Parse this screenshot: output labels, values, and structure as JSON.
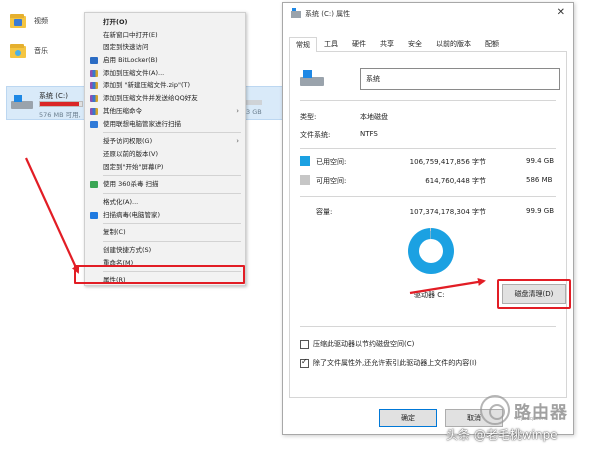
{
  "explorer": {
    "folders": [
      {
        "label": "视频",
        "icon": "video-folder-icon"
      },
      {
        "label": "音乐",
        "icon": "music-folder-icon"
      }
    ],
    "drive": {
      "name": "系统 (C:)",
      "free_text": "576 MB 可用,",
      "usage_fraction": 0.92,
      "bar_color": "#da2626"
    },
    "drive2_free_text": "3 GB"
  },
  "context_menu": {
    "items": [
      {
        "label": "打开(O)",
        "bold": true
      },
      {
        "label": "在新窗口中打开(E)"
      },
      {
        "label": "固定到快速访问"
      },
      {
        "label": "启用 BitLocker(B)",
        "icon": "bitlocker-shield-icon"
      },
      {
        "label": "添加到压缩文件(A)...",
        "icon": "winrar-icon"
      },
      {
        "label": "添加到 \"新建压缩文件.zip\"(T)",
        "icon": "winrar-icon"
      },
      {
        "label": "添加到压缩文件并发送给QQ好友",
        "icon": "winrar-icon"
      },
      {
        "label": "其他压缩命令",
        "icon": "winrar-icon",
        "submenu": true
      },
      {
        "label": "使用联想电脑管家进行扫描",
        "icon": "lenovo-manager-icon"
      },
      {
        "label": "授予访问权限(G)",
        "submenu": true,
        "separator_before": true
      },
      {
        "label": "还原以前的版本(V)"
      },
      {
        "label": "固定到\"开始\"屏幕(P)"
      },
      {
        "label": "使用 360杀毒 扫描",
        "icon": "360-antivirus-icon",
        "separator_before": true
      },
      {
        "label": "格式化(A)...",
        "separator_before": true
      },
      {
        "label": "扫描病毒(电脑管家)",
        "icon": "qq-manager-shield-icon"
      },
      {
        "label": "复制(C)",
        "separator_before": true
      },
      {
        "label": "创建快捷方式(S)",
        "separator_before": true
      },
      {
        "label": "重命名(M)"
      },
      {
        "label": "属性(R)",
        "separator_before": true
      }
    ]
  },
  "dialog": {
    "title": "系统 (C:) 属性",
    "close_glyph": "✕",
    "tabs": [
      {
        "label": "常规",
        "active": true
      },
      {
        "label": "工具"
      },
      {
        "label": "硬件"
      },
      {
        "label": "共享"
      },
      {
        "label": "安全"
      },
      {
        "label": "以前的版本"
      },
      {
        "label": "配额"
      }
    ],
    "volume_name": "系统",
    "type_label": "类型:",
    "type_value": "本地磁盘",
    "fs_label": "文件系统:",
    "fs_value": "NTFS",
    "used_label": "已用空间:",
    "used_bytes": "106,759,417,856 字节",
    "used_size": "99.4 GB",
    "free_label": "可用空间:",
    "free_bytes": "614,760,448 字节",
    "free_size": "586 MB",
    "capacity_label": "容量:",
    "capacity_bytes": "107,374,178,304 字节",
    "capacity_size": "99.9 GB",
    "drive_label": "驱动器 C:",
    "used_fraction": 0.994,
    "used_color": "#1ba1e2",
    "free_color": "#c6c6c6",
    "cleanup_button": "磁盘清理(D)",
    "compress_option": "压缩此驱动器以节约磁盘空间(C)",
    "compress_checked": false,
    "index_option": "除了文件属性外,还允许索引此驱动器上文件的内容(I)",
    "index_checked": true,
    "ok_button": "确定",
    "cancel_button": "取消"
  },
  "annotation": {
    "highlight_color": "#e21d25"
  },
  "watermark": {
    "brand_text": "路由器",
    "brand_sub": "luyouqi.com",
    "author": "头条 @老毛桃winpe"
  }
}
